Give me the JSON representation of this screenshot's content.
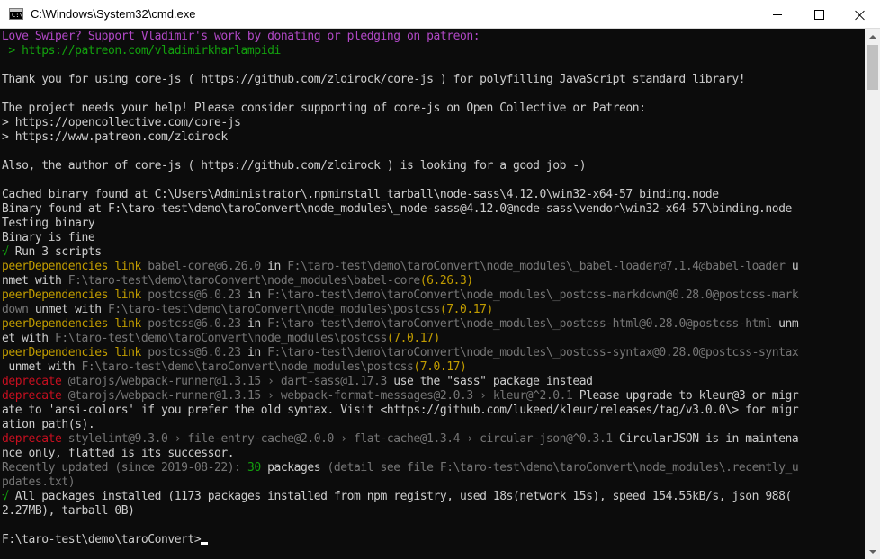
{
  "window": {
    "title": "C:\\Windows\\System32\\cmd.exe",
    "icon_glyph": "C:\\"
  },
  "colors": {
    "default": "#cccccc",
    "magenta": "#b148c6",
    "green": "#13a10e",
    "yellow": "#c19c00",
    "gray": "#767676",
    "red": "#c50f1f",
    "white": "#f2f2f2",
    "background": "#0c0c0c"
  },
  "console": {
    "lines": [
      [
        {
          "t": "Love Swiper? Support Vladimir's work by donating or pledging on patreon:",
          "c": "magenta"
        }
      ],
      [
        {
          "t": " > https://patreon.com/vladimirkharlampidi",
          "c": "green"
        }
      ],
      [
        {
          "t": "",
          "c": "default"
        }
      ],
      [
        {
          "t": "Thank you for using core-js ( https://github.com/zloirock/core-js ) for polyfilling JavaScript standard library!",
          "c": "default"
        }
      ],
      [
        {
          "t": "",
          "c": "default"
        }
      ],
      [
        {
          "t": "The project needs your help! Please consider supporting of core-js on Open Collective or Patreon:",
          "c": "default"
        }
      ],
      [
        {
          "t": "> https://opencollective.com/core-js",
          "c": "default"
        }
      ],
      [
        {
          "t": "> https://www.patreon.com/zloirock",
          "c": "default"
        }
      ],
      [
        {
          "t": "",
          "c": "default"
        }
      ],
      [
        {
          "t": "Also, the author of core-js ( https://github.com/zloirock ) is looking for a good job -)",
          "c": "default"
        }
      ],
      [
        {
          "t": "",
          "c": "default"
        }
      ],
      [
        {
          "t": "Cached binary found at C:\\Users\\Administrator\\.npminstall_tarball\\node-sass\\4.12.0\\win32-x64-57_binding.node",
          "c": "default"
        }
      ],
      [
        {
          "t": "Binary found at F:\\taro-test\\demo\\taroConvert\\node_modules\\_node-sass@4.12.0@node-sass\\vendor\\win32-x64-57\\binding.node",
          "c": "default"
        }
      ],
      [
        {
          "t": "Testing binary",
          "c": "default"
        }
      ],
      [
        {
          "t": "Binary is fine",
          "c": "default"
        }
      ],
      [
        {
          "t": "√",
          "c": "green"
        },
        {
          "t": " Run 3 scripts",
          "c": "default"
        }
      ],
      [
        {
          "t": "peerDependencies link ",
          "c": "yellow"
        },
        {
          "t": "babel-core@6.26.0",
          "c": "gray"
        },
        {
          "t": " in ",
          "c": "default"
        },
        {
          "t": "F:\\taro-test\\demo\\taroConvert\\node_modules\\_babel-loader@7.1.4@babel-loader",
          "c": "gray"
        },
        {
          "t": " u",
          "c": "default"
        }
      ],
      [
        {
          "t": "nmet with ",
          "c": "default"
        },
        {
          "t": "F:\\taro-test\\demo\\taroConvert\\node_modules\\babel-core",
          "c": "gray"
        },
        {
          "t": "(6.26.3)",
          "c": "yellow"
        }
      ],
      [
        {
          "t": "peerDependencies link ",
          "c": "yellow"
        },
        {
          "t": "postcss@6.0.23",
          "c": "gray"
        },
        {
          "t": " in ",
          "c": "default"
        },
        {
          "t": "F:\\taro-test\\demo\\taroConvert\\node_modules\\_postcss-markdown@0.28.0@postcss-mark",
          "c": "gray"
        }
      ],
      [
        {
          "t": "down",
          "c": "gray"
        },
        {
          "t": " unmet with ",
          "c": "default"
        },
        {
          "t": "F:\\taro-test\\demo\\taroConvert\\node_modules\\postcss",
          "c": "gray"
        },
        {
          "t": "(7.0.17)",
          "c": "yellow"
        }
      ],
      [
        {
          "t": "peerDependencies link ",
          "c": "yellow"
        },
        {
          "t": "postcss@6.0.23",
          "c": "gray"
        },
        {
          "t": " in ",
          "c": "default"
        },
        {
          "t": "F:\\taro-test\\demo\\taroConvert\\node_modules\\_postcss-html@0.28.0@postcss-html",
          "c": "gray"
        },
        {
          "t": " unm",
          "c": "default"
        }
      ],
      [
        {
          "t": "et with ",
          "c": "default"
        },
        {
          "t": "F:\\taro-test\\demo\\taroConvert\\node_modules\\postcss",
          "c": "gray"
        },
        {
          "t": "(7.0.17)",
          "c": "yellow"
        }
      ],
      [
        {
          "t": "peerDependencies link ",
          "c": "yellow"
        },
        {
          "t": "postcss@6.0.23",
          "c": "gray"
        },
        {
          "t": " in ",
          "c": "default"
        },
        {
          "t": "F:\\taro-test\\demo\\taroConvert\\node_modules\\_postcss-syntax@0.28.0@postcss-syntax",
          "c": "gray"
        }
      ],
      [
        {
          "t": " unmet with ",
          "c": "default"
        },
        {
          "t": "F:\\taro-test\\demo\\taroConvert\\node_modules\\postcss",
          "c": "gray"
        },
        {
          "t": "(7.0.17)",
          "c": "yellow"
        }
      ],
      [
        {
          "t": "deprecate ",
          "c": "red"
        },
        {
          "t": "@tarojs/webpack-runner@1.3.15 › dart-sass@1.17.3",
          "c": "gray"
        },
        {
          "t": " use the \"sass\" package instead",
          "c": "default"
        }
      ],
      [
        {
          "t": "deprecate ",
          "c": "red"
        },
        {
          "t": "@tarojs/webpack-runner@1.3.15 › webpack-format-messages@2.0.3 › kleur@^2.0.1",
          "c": "gray"
        },
        {
          "t": " Please upgrade to kleur@3 or migr",
          "c": "default"
        }
      ],
      [
        {
          "t": "ate to 'ansi-colors' if you prefer the old syntax. Visit <https://github.com/lukeed/kleur/releases/tag/v3.0.0\\> for migr",
          "c": "default"
        }
      ],
      [
        {
          "t": "ation path(s).",
          "c": "default"
        }
      ],
      [
        {
          "t": "deprecate ",
          "c": "red"
        },
        {
          "t": "stylelint@9.3.0 › file-entry-cache@2.0.0 › flat-cache@1.3.4 › circular-json@^0.3.1",
          "c": "gray"
        },
        {
          "t": " CircularJSON is in maintena",
          "c": "default"
        }
      ],
      [
        {
          "t": "nce only, flatted is its successor.",
          "c": "default"
        }
      ],
      [
        {
          "t": "Recently updated (since 2019-08-22): ",
          "c": "gray"
        },
        {
          "t": "30",
          "c": "green"
        },
        {
          "t": " packages ",
          "c": "default"
        },
        {
          "t": "(detail see file F:\\taro-test\\demo\\taroConvert\\node_modules\\.recently_u",
          "c": "gray"
        }
      ],
      [
        {
          "t": "pdates.txt)",
          "c": "gray"
        }
      ],
      [
        {
          "t": "√",
          "c": "green"
        },
        {
          "t": " All packages installed (1173 packages installed from npm registry, used 18s(network 15s), speed 154.55kB/s, json 988(",
          "c": "default"
        }
      ],
      [
        {
          "t": "2.27MB), tarball 0B)",
          "c": "default"
        }
      ],
      [
        {
          "t": "",
          "c": "default"
        }
      ],
      [
        {
          "t": "F:\\taro-test\\demo\\taroConvert>",
          "c": "default"
        }
      ]
    ]
  }
}
